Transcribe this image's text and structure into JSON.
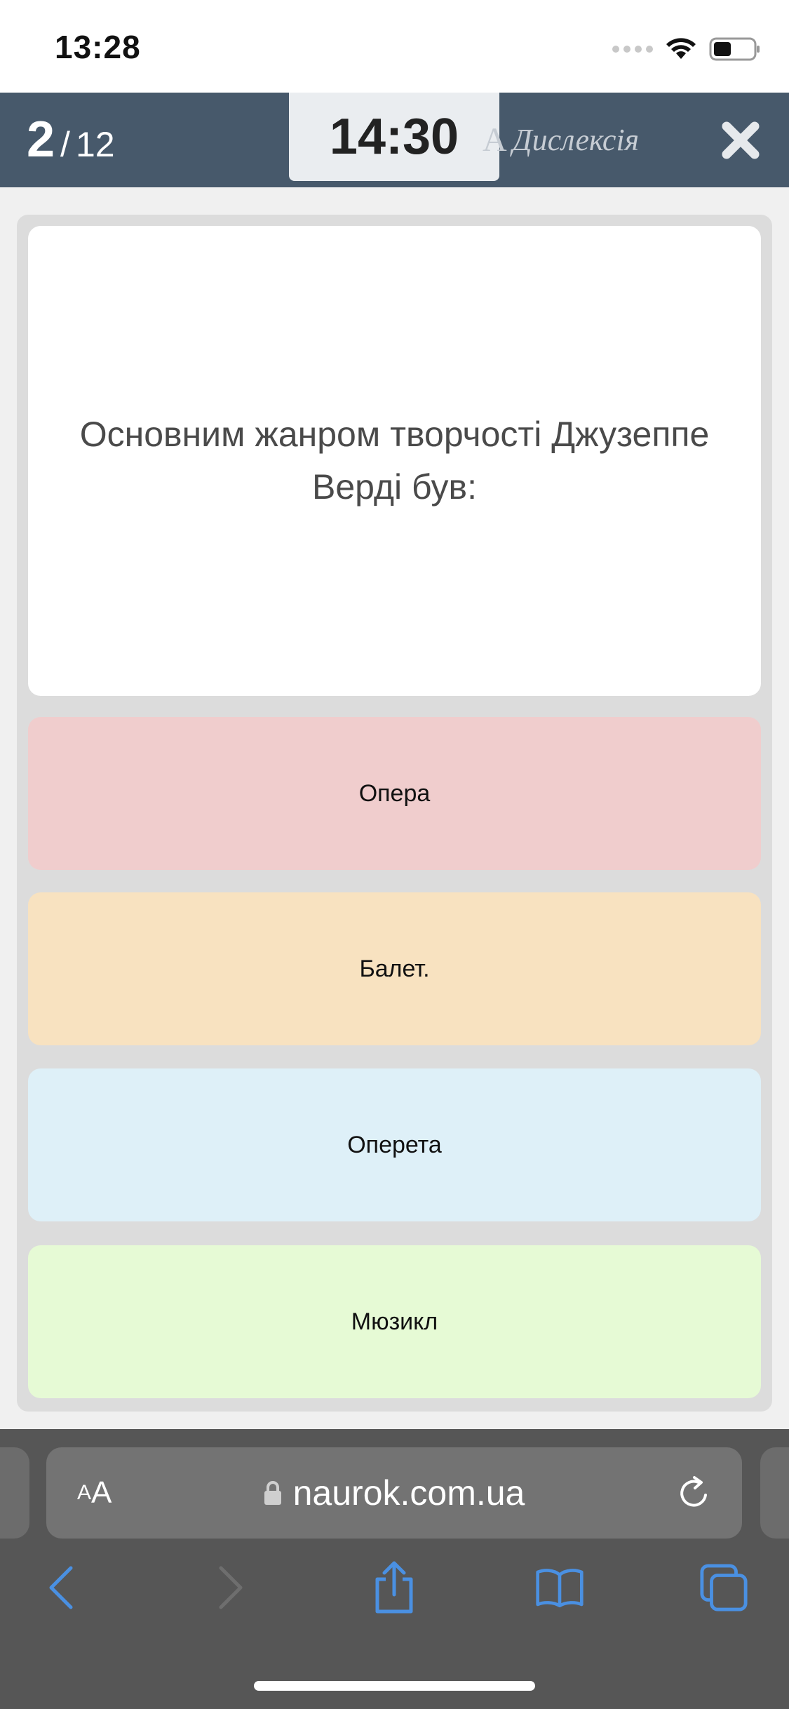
{
  "status_bar": {
    "time": "13:28",
    "icons": [
      "signal-dots-icon",
      "wifi-icon",
      "battery-icon"
    ]
  },
  "quiz_header": {
    "current": "2",
    "separator": "/",
    "total": "12",
    "timer": "14:30",
    "dyslexia_glyph": "A",
    "dyslexia_label": "Дислексія"
  },
  "question": {
    "text": "Основним жанром творчості Джузеппе Верді був:"
  },
  "answers": [
    {
      "label": "Опера",
      "color": "#f0cdcd"
    },
    {
      "label": "Балет.",
      "color": "#f8e2c0"
    },
    {
      "label": "Оперета",
      "color": "#def0f8"
    },
    {
      "label": "Мюзикл",
      "color": "#e6fad5"
    }
  ],
  "browser": {
    "aa_small": "A",
    "aa_big": "A",
    "url": "naurok.com.ua",
    "accent": "#4a90e2"
  }
}
